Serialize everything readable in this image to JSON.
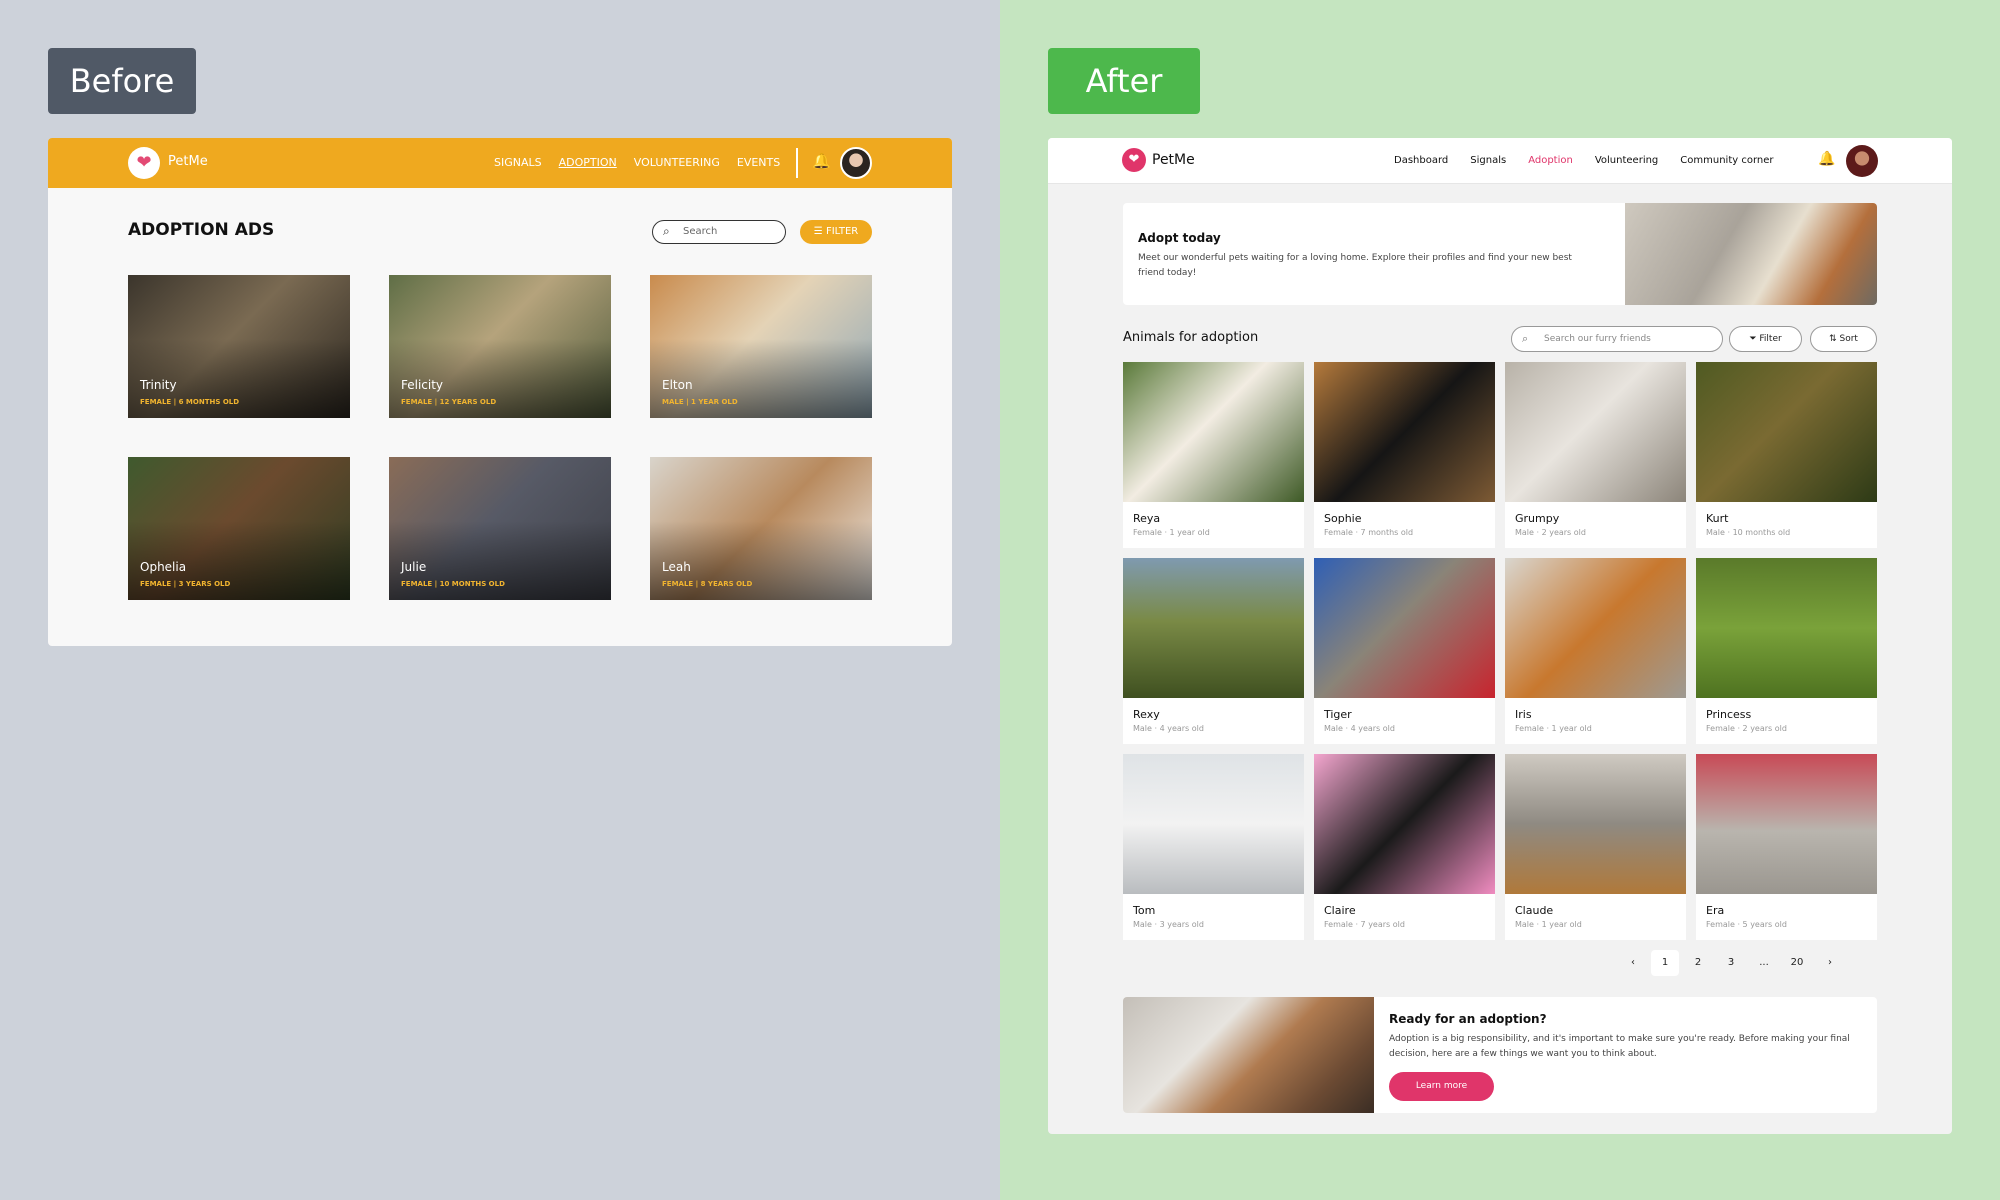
{
  "labels": {
    "before": "Before",
    "after": "After"
  },
  "before": {
    "brand": "PetMe",
    "nav": [
      "SIGNALS",
      "ADOPTION",
      "VOLUNTEERING",
      "EVENTS"
    ],
    "title": "ADOPTION ADS",
    "search_placeholder": "Search",
    "filter_label": "FILTER",
    "pets": [
      {
        "name": "Trinity",
        "meta": "FEMALE | 6 MONTHS OLD"
      },
      {
        "name": "Felicity",
        "meta": "FEMALE | 12 YEARS OLD"
      },
      {
        "name": "Elton",
        "meta": "MALE | 1 YEAR OLD"
      },
      {
        "name": "Ophelia",
        "meta": "FEMALE | 3 YEARS OLD"
      },
      {
        "name": "Julie",
        "meta": "FEMALE | 10 MONTHS OLD"
      },
      {
        "name": "Leah",
        "meta": "FEMALE | 8 YEARS OLD"
      }
    ]
  },
  "after": {
    "brand": "PetMe",
    "nav": [
      "Dashboard",
      "Signals",
      "Adoption",
      "Volunteering",
      "Community corner"
    ],
    "hero": {
      "title": "Adopt today",
      "text": "Meet our wonderful pets waiting for a loving home. Explore their profiles and find your new best friend today!"
    },
    "section_title": "Animals for adoption",
    "search_placeholder": "Search our furry friends",
    "filter_label": "Filter",
    "sort_label": "Sort",
    "pets": [
      {
        "name": "Reya",
        "meta": "Female · 1 year old"
      },
      {
        "name": "Sophie",
        "meta": "Female · 7 months old"
      },
      {
        "name": "Grumpy",
        "meta": "Male · 2 years old"
      },
      {
        "name": "Kurt",
        "meta": "Male · 10 months old"
      },
      {
        "name": "Rexy",
        "meta": "Male · 4 years old"
      },
      {
        "name": "Tiger",
        "meta": "Male · 4 years old"
      },
      {
        "name": "Iris",
        "meta": "Female · 1 year old"
      },
      {
        "name": "Princess",
        "meta": "Female · 2 years old"
      },
      {
        "name": "Tom",
        "meta": "Male · 3 years old"
      },
      {
        "name": "Claire",
        "meta": "Female · 7 years old"
      },
      {
        "name": "Claude",
        "meta": "Male · 1 year old"
      },
      {
        "name": "Era",
        "meta": "Female · 5 years old"
      }
    ],
    "pagination": [
      "1",
      "2",
      "3",
      "...",
      "20"
    ],
    "cta": {
      "title": "Ready for an adoption?",
      "text": "Adoption is a big responsibility, and it's important to make sure you're ready. Before making your final decision, here are a few things we want you to think about.",
      "button": "Learn more"
    }
  }
}
